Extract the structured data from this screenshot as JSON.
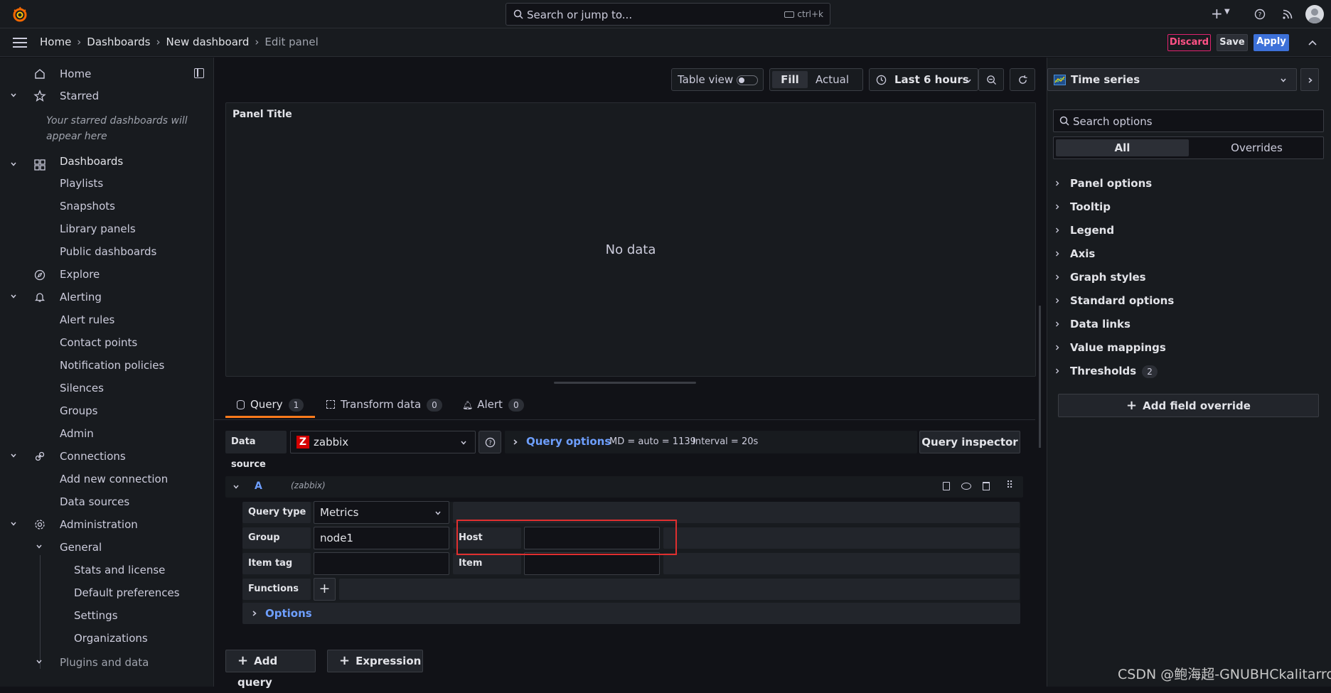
{
  "topbar": {
    "search_placeholder": "Search or jump to...",
    "search_shortcut": "ctrl+k",
    "icons": [
      "grafana-logo-icon",
      "search-icon",
      "keyboard-icon",
      "plus-icon",
      "chevron-down-icon",
      "help-icon",
      "rss-icon",
      "avatar"
    ]
  },
  "breadcrumb": {
    "items": [
      "Home",
      "Dashboards",
      "New dashboard",
      "Edit panel"
    ]
  },
  "actions": {
    "discard": "Discard",
    "save": "Save",
    "apply": "Apply"
  },
  "sidebar": {
    "home": "Home",
    "starred": "Starred",
    "starred_note": "Your starred dashboards will appear here",
    "dashboards": "Dashboards",
    "dashboards_children": [
      "Playlists",
      "Snapshots",
      "Library panels",
      "Public dashboards"
    ],
    "explore": "Explore",
    "alerting": "Alerting",
    "alerting_children": [
      "Alert rules",
      "Contact points",
      "Notification policies",
      "Silences",
      "Groups",
      "Admin"
    ],
    "connections": "Connections",
    "connections_children": [
      "Add new connection",
      "Data sources"
    ],
    "administration": "Administration",
    "general": "General",
    "general_children": [
      "Stats and license",
      "Default preferences",
      "Settings",
      "Organizations"
    ],
    "plugins_and_data": "Plugins and data"
  },
  "toolbar": {
    "table_view": "Table view",
    "fill": "Fill",
    "actual": "Actual",
    "time_range": "Last 6 hours"
  },
  "panel": {
    "title": "Panel Title",
    "no_data": "No data"
  },
  "tabs": [
    {
      "label": "Query",
      "count": "1"
    },
    {
      "label": "Transform data",
      "count": "0"
    },
    {
      "label": "Alert",
      "count": "0"
    }
  ],
  "query": {
    "data_source_label": "Data source",
    "data_source_value": "zabbix",
    "query_options": "Query options",
    "md_info": "MD = auto = 1139",
    "interval_info": "Interval = 20s",
    "query_inspector": "Query inspector",
    "ref_id": "A",
    "ref_source": "(zabbix)",
    "query_type_label": "Query type",
    "query_type_value": "Metrics",
    "group_label": "Group",
    "group_value": "node1",
    "host_label": "Host",
    "host_value": "",
    "item_tag_label": "Item tag",
    "item_tag_value": "",
    "item_label": "Item",
    "item_value": "",
    "functions_label": "Functions",
    "options_label": "Options",
    "add_query": "Add query",
    "expression": "Expression"
  },
  "options_pane": {
    "visualization": "Time series",
    "search_placeholder": "Search options",
    "tab_all": "All",
    "tab_overrides": "Overrides",
    "sections": [
      "Panel options",
      "Tooltip",
      "Legend",
      "Axis",
      "Graph styles",
      "Standard options",
      "Data links",
      "Value mappings",
      "Thresholds"
    ],
    "thresholds_count": "2",
    "add_field_override": "Add field override"
  },
  "watermark": "CSDN @鲍海超-GNUBHCkalitarro",
  "colors": {
    "accent_orange": "#ff7a1c",
    "apply_blue": "#3d71d9",
    "discard_pink": "#ff5286",
    "link_blue": "#6e9fff",
    "highlight_red": "#e02f2f"
  }
}
